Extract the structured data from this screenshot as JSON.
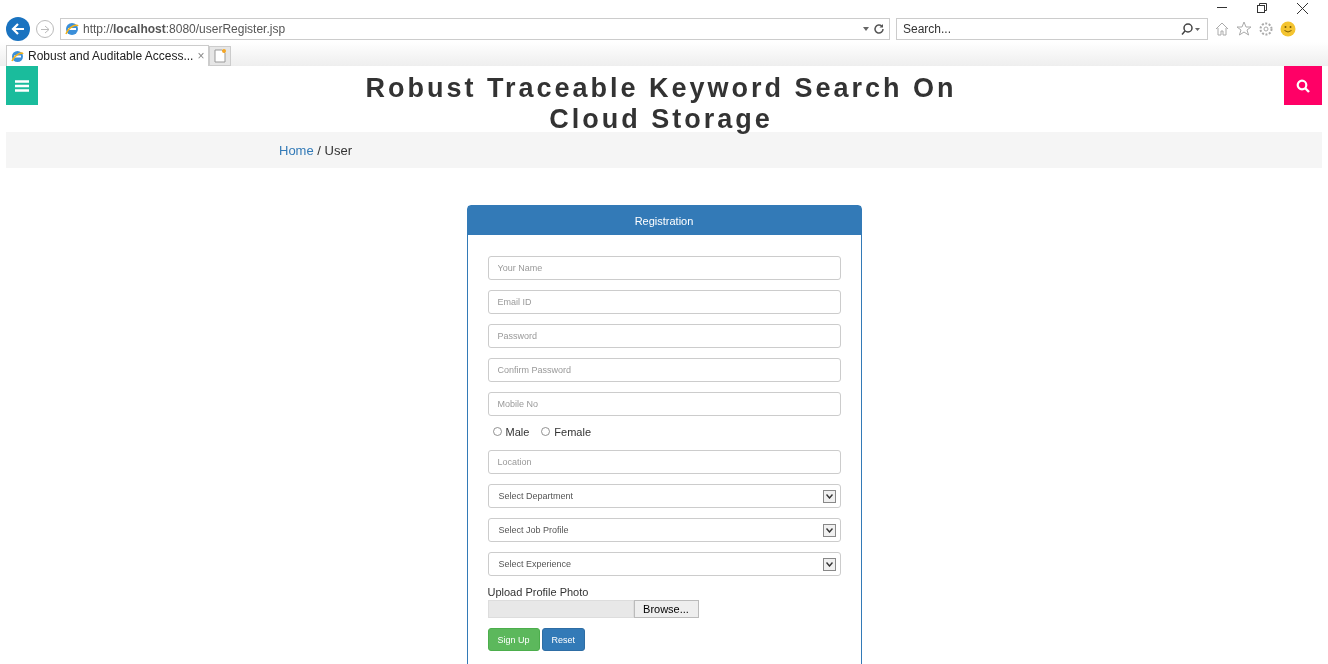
{
  "browser": {
    "url": "http://**localhost**:8080/userRegister.jsp",
    "search_placeholder": "Search...",
    "tabs": [
      {
        "title": "Robust and Auditable Access...",
        "close": "×",
        "selected": true
      }
    ]
  },
  "header": {
    "title": "Robust Traceable Keyword Search On Cloud Storage"
  },
  "breadcrumb": [
    {
      "label": "Home",
      "kind": "link"
    },
    {
      "label": " / User",
      "kind": "current"
    }
  ],
  "form": {
    "title": "Registration",
    "fields": [
      {
        "kind": "input",
        "placeholder": "Your Name"
      },
      {
        "kind": "input",
        "placeholder": "Email ID"
      },
      {
        "kind": "input",
        "placeholder": "Password"
      },
      {
        "kind": "input",
        "placeholder": "Confirm Password"
      },
      {
        "kind": "input",
        "placeholder": "Mobile No"
      },
      {
        "kind": "radios",
        "options": [
          {
            "label": "Male",
            "selected": false
          },
          {
            "label": "Female",
            "selected": false
          }
        ]
      },
      {
        "kind": "input",
        "placeholder": "Location"
      },
      {
        "kind": "select",
        "value": "Select Department"
      },
      {
        "kind": "select",
        "value": "Select Job Profile"
      },
      {
        "kind": "select",
        "value": "Select Experience"
      },
      {
        "kind": "file",
        "label": "Upload Profile Photo",
        "button": "Browse..."
      }
    ],
    "buttons": [
      {
        "label": "Sign Up",
        "kind": "success"
      },
      {
        "label": "Reset",
        "kind": "primary"
      }
    ]
  }
}
